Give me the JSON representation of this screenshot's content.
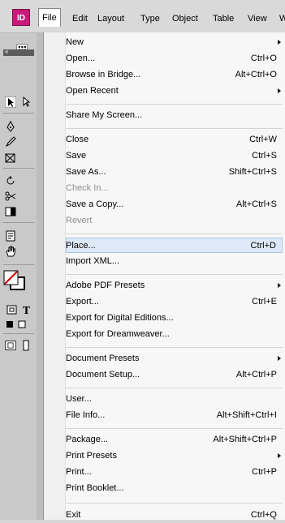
{
  "app": {
    "badge": "ID"
  },
  "menubar": {
    "items": [
      {
        "label": "File"
      },
      {
        "label": "Edit"
      },
      {
        "label": "Layout"
      },
      {
        "label": "Type"
      },
      {
        "label": "Object"
      },
      {
        "label": "Table"
      },
      {
        "label": "View"
      },
      {
        "label": "W"
      }
    ]
  },
  "file_menu": {
    "new": {
      "label": "New"
    },
    "open": {
      "label": "Open...",
      "shortcut": "Ctrl+O"
    },
    "browse_in_bridge": {
      "label": "Browse in Bridge...",
      "shortcut": "Alt+Ctrl+O"
    },
    "open_recent": {
      "label": "Open Recent"
    },
    "share_my_screen": {
      "label": "Share My Screen..."
    },
    "close": {
      "label": "Close",
      "shortcut": "Ctrl+W"
    },
    "save": {
      "label": "Save",
      "shortcut": "Ctrl+S"
    },
    "save_as": {
      "label": "Save As...",
      "shortcut": "Shift+Ctrl+S"
    },
    "check_in": {
      "label": "Check In..."
    },
    "save_a_copy": {
      "label": "Save a Copy...",
      "shortcut": "Alt+Ctrl+S"
    },
    "revert": {
      "label": "Revert"
    },
    "place": {
      "label": "Place...",
      "shortcut": "Ctrl+D"
    },
    "import_xml": {
      "label": "Import XML..."
    },
    "adobe_pdf_presets": {
      "label": "Adobe PDF Presets"
    },
    "export": {
      "label": "Export...",
      "shortcut": "Ctrl+E"
    },
    "export_digital_editions": {
      "label": "Export for Digital Editions..."
    },
    "export_dreamweaver": {
      "label": "Export for Dreamweaver..."
    },
    "document_presets": {
      "label": "Document Presets"
    },
    "document_setup": {
      "label": "Document Setup...",
      "shortcut": "Alt+Ctrl+P"
    },
    "user": {
      "label": "User..."
    },
    "file_info": {
      "label": "File Info...",
      "shortcut": "Alt+Shift+Ctrl+I"
    },
    "package": {
      "label": "Package...",
      "shortcut": "Alt+Shift+Ctrl+P"
    },
    "print_presets": {
      "label": "Print Presets"
    },
    "print": {
      "label": "Print...",
      "shortcut": "Ctrl+P"
    },
    "print_booklet": {
      "label": "Print Booklet..."
    },
    "exit": {
      "label": "Exit",
      "shortcut": "Ctrl+Q"
    }
  },
  "colors": {
    "app_badge": "#c9197a",
    "highlight": "#dde9f7",
    "disabled_text": "#8f8f8f"
  },
  "icons": [
    "selection-tool-icon",
    "direct-selection-tool-icon",
    "pen-tool-icon",
    "pencil-tool-icon",
    "rectangle-frame-tool-icon",
    "rotate-tool-icon",
    "scissors-tool-icon",
    "gradient-tool-icon",
    "note-tool-icon",
    "hand-tool-icon",
    "fill-stroke-icon",
    "formatting-container-icon",
    "view-mode-icon",
    "screen-mode-icon"
  ]
}
